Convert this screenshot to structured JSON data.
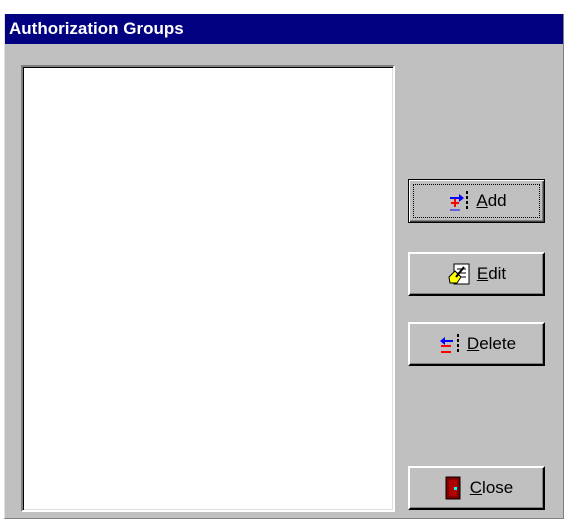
{
  "window": {
    "title": "Authorization Groups"
  },
  "list": {
    "items": []
  },
  "buttons": {
    "add": {
      "mnemonic": "A",
      "rest": "dd",
      "icon": "add-record-icon"
    },
    "edit": {
      "mnemonic": "E",
      "rest": "dit",
      "icon": "edit-document-icon"
    },
    "delete": {
      "mnemonic": "D",
      "rest": "elete",
      "icon": "delete-record-icon"
    },
    "close": {
      "mnemonic": "C",
      "rest": "lose",
      "icon": "door-exit-icon"
    }
  },
  "colors": {
    "title_bar": "#000080",
    "face": "#c0c0c0",
    "list_background": "#ffffff"
  }
}
